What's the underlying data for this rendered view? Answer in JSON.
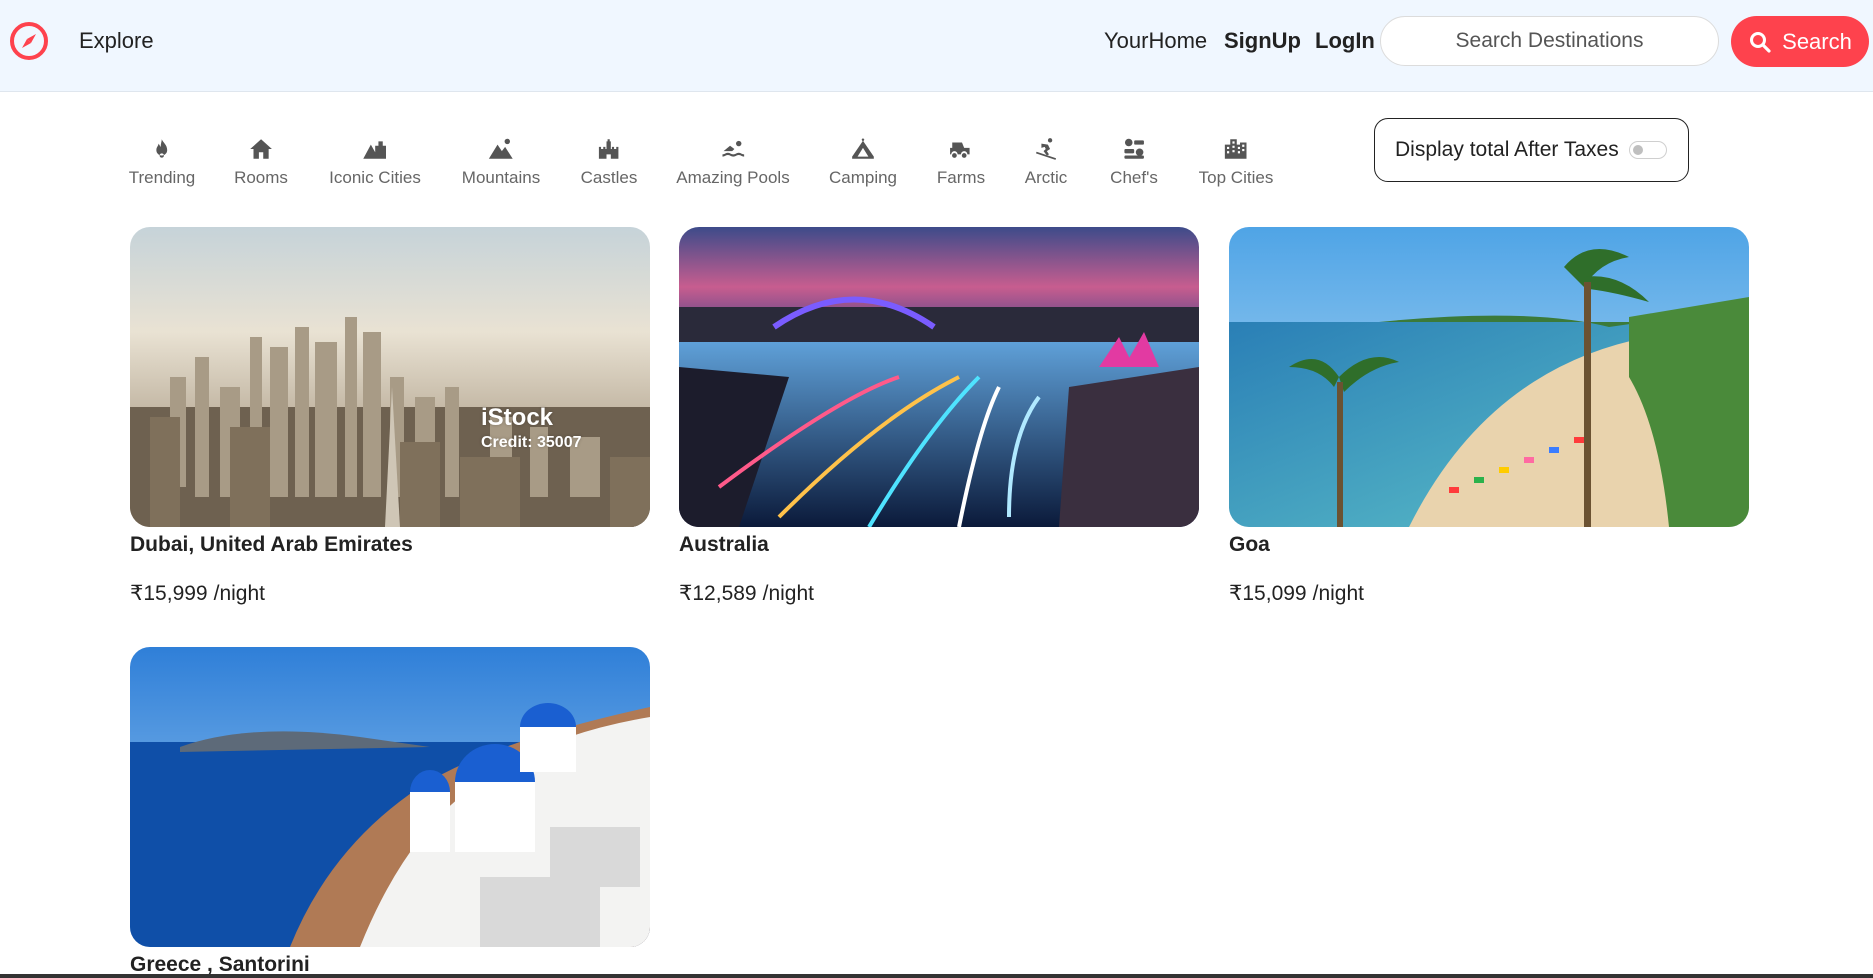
{
  "colors": {
    "brand": "#fe424d",
    "navbar_bg": "#f0f7ff"
  },
  "navbar": {
    "logo_icon": "compass-icon",
    "explore_label": "Explore",
    "links": {
      "home": "YourHome",
      "signup": "SignUp",
      "login": "LogIn"
    },
    "search": {
      "placeholder": "Search Destinations",
      "value": "",
      "button_label": "Search",
      "button_icon": "search-icon"
    }
  },
  "filters": [
    {
      "label": "Trending",
      "icon": "fire-icon"
    },
    {
      "label": "Rooms",
      "icon": "bed-icon"
    },
    {
      "label": "Iconic Cities",
      "icon": "mountain-city-icon"
    },
    {
      "label": "Mountains",
      "icon": "mountain-icon"
    },
    {
      "label": "Castles",
      "icon": "castle-icon"
    },
    {
      "label": "Amazing Pools",
      "icon": "person-swimming-icon"
    },
    {
      "label": "Camping",
      "icon": "campground-icon"
    },
    {
      "label": "Farms",
      "icon": "tractor-icon"
    },
    {
      "label": "Arctic",
      "icon": "person-skiing-icon"
    },
    {
      "label": "Chef's",
      "icon": "kitchen-icon"
    },
    {
      "label": "Top Cities",
      "icon": "city-icon"
    }
  ],
  "tax_toggle": {
    "label": "Display total After Taxes",
    "enabled": false
  },
  "listings": [
    {
      "title": "Dubai, United Arab Emirates",
      "currency": "₹",
      "price": "15,999",
      "rate": "/night",
      "image": "dubai-skyline-photo",
      "watermark": {
        "brand": "iStock",
        "credit": "Credit: 35007"
      }
    },
    {
      "title": "Australia",
      "currency": "₹",
      "price": "12,589",
      "rate": "/night",
      "image": "sydney-harbour-night-photo"
    },
    {
      "title": "Goa",
      "currency": "₹",
      "price": "15,099",
      "rate": "/night",
      "image": "goa-beach-photo"
    },
    {
      "title": "Greece , Santorini",
      "image": "santorini-photo"
    }
  ]
}
